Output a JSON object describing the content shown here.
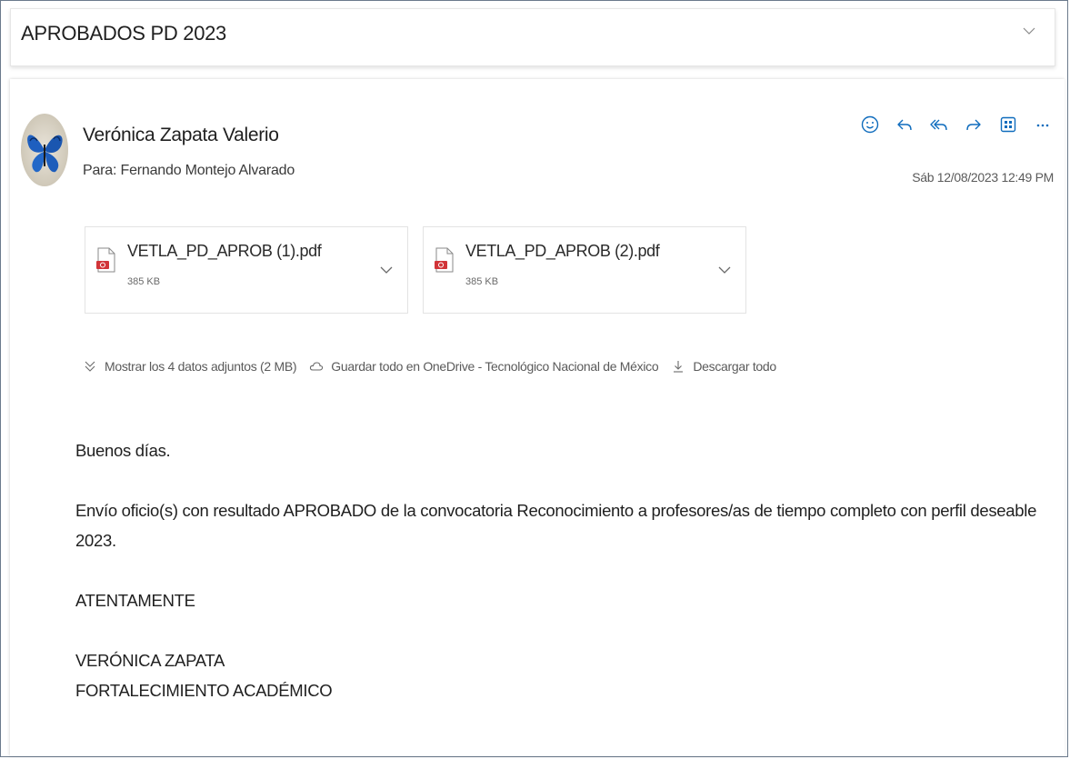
{
  "subject": "APROBADOS PD 2023",
  "sender": {
    "name": "Verónica Zapata Valerio",
    "to_label": "Para:",
    "to_name": "Fernando Montejo Alvarado",
    "date": "Sáb 12/08/2023 12:49 PM"
  },
  "toolbar": {
    "icons": [
      "emoji-icon",
      "reply-icon",
      "reply-all-icon",
      "forward-icon",
      "apps-icon",
      "more-icon"
    ],
    "accent_color": "#0f6cbd"
  },
  "attachments": [
    {
      "name": "VETLA_PD_APROB (1).pdf",
      "size": "385 KB",
      "icon": "pdf-icon"
    },
    {
      "name": "VETLA_PD_APROB (2).pdf",
      "size": "385 KB",
      "icon": "pdf-icon"
    }
  ],
  "attachment_bar": {
    "show_all": "Mostrar los 4 datos adjuntos (2 MB)",
    "save_onedrive": "Guardar todo en OneDrive - Tecnológico Nacional de México",
    "download_all": "Descargar todo"
  },
  "body": {
    "greeting": "Buenos días.",
    "paragraph_1": "Envío oficio(s) con resultado APROBADO de la convocatoria Reconocimiento a profesores/as de tiempo completo con perfil deseable 2023.",
    "closing": "ATENTAMENTE",
    "signature_name": "VERÓNICA ZAPATA",
    "signature_dept": "FORTALECIMIENTO ACADÉMICO"
  }
}
